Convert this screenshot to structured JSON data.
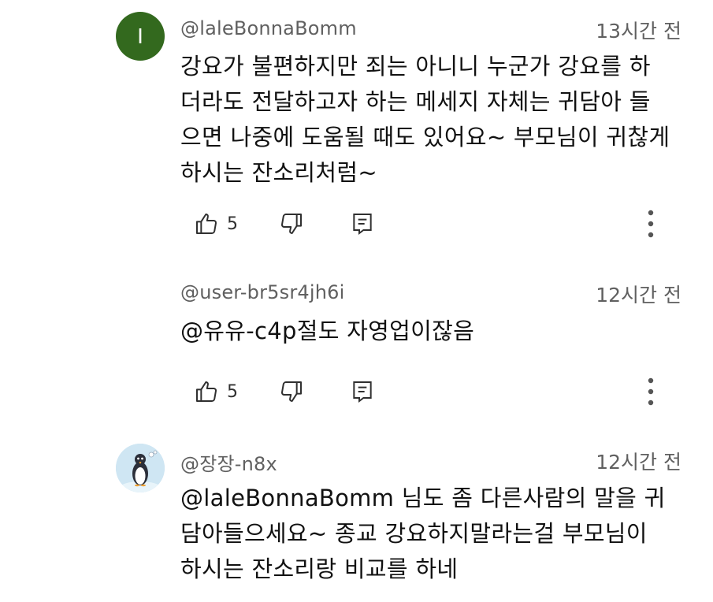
{
  "comments": [
    {
      "avatar_letter": "I",
      "avatar_color": "#33691e",
      "handle": "@laleBonnaBomm",
      "time": "13시간 전",
      "lines": [
        "강요가 불편하지만 죄는 아니니 누군가 강요를 하",
        "더라도 전달하고자 하는 메세지 자체는 귀담아 들",
        "으면 나중에 도움될 때도 있어요~ 부모님이 귀찮게",
        "하시는 잔소리처럼~"
      ],
      "likes": "5"
    },
    {
      "handle": "@user-br5sr4jh6i",
      "time": "12시간 전",
      "lines": [
        "@유유-c4p절도 자영업이잖음"
      ],
      "likes": "5"
    },
    {
      "avatar_icon": "penguin-icon",
      "handle": "@장장-n8x",
      "time": "12시간 전",
      "lines": [
        "@laleBonnaBomm 님도 좀 다른사람의 말을 귀",
        "담아들으세요~ 종교 강요하지말라는걸 부모님이",
        "하시는 잔소리랑 비교를 하네"
      ]
    }
  ],
  "icons": {
    "like": "thumbs-up-icon",
    "dislike": "thumbs-down-icon",
    "reply": "reply-icon",
    "more": "more-vert-icon"
  },
  "colors": {
    "meta_text": "#606060",
    "body_text": "#111111",
    "avatar_green": "#33691e"
  }
}
